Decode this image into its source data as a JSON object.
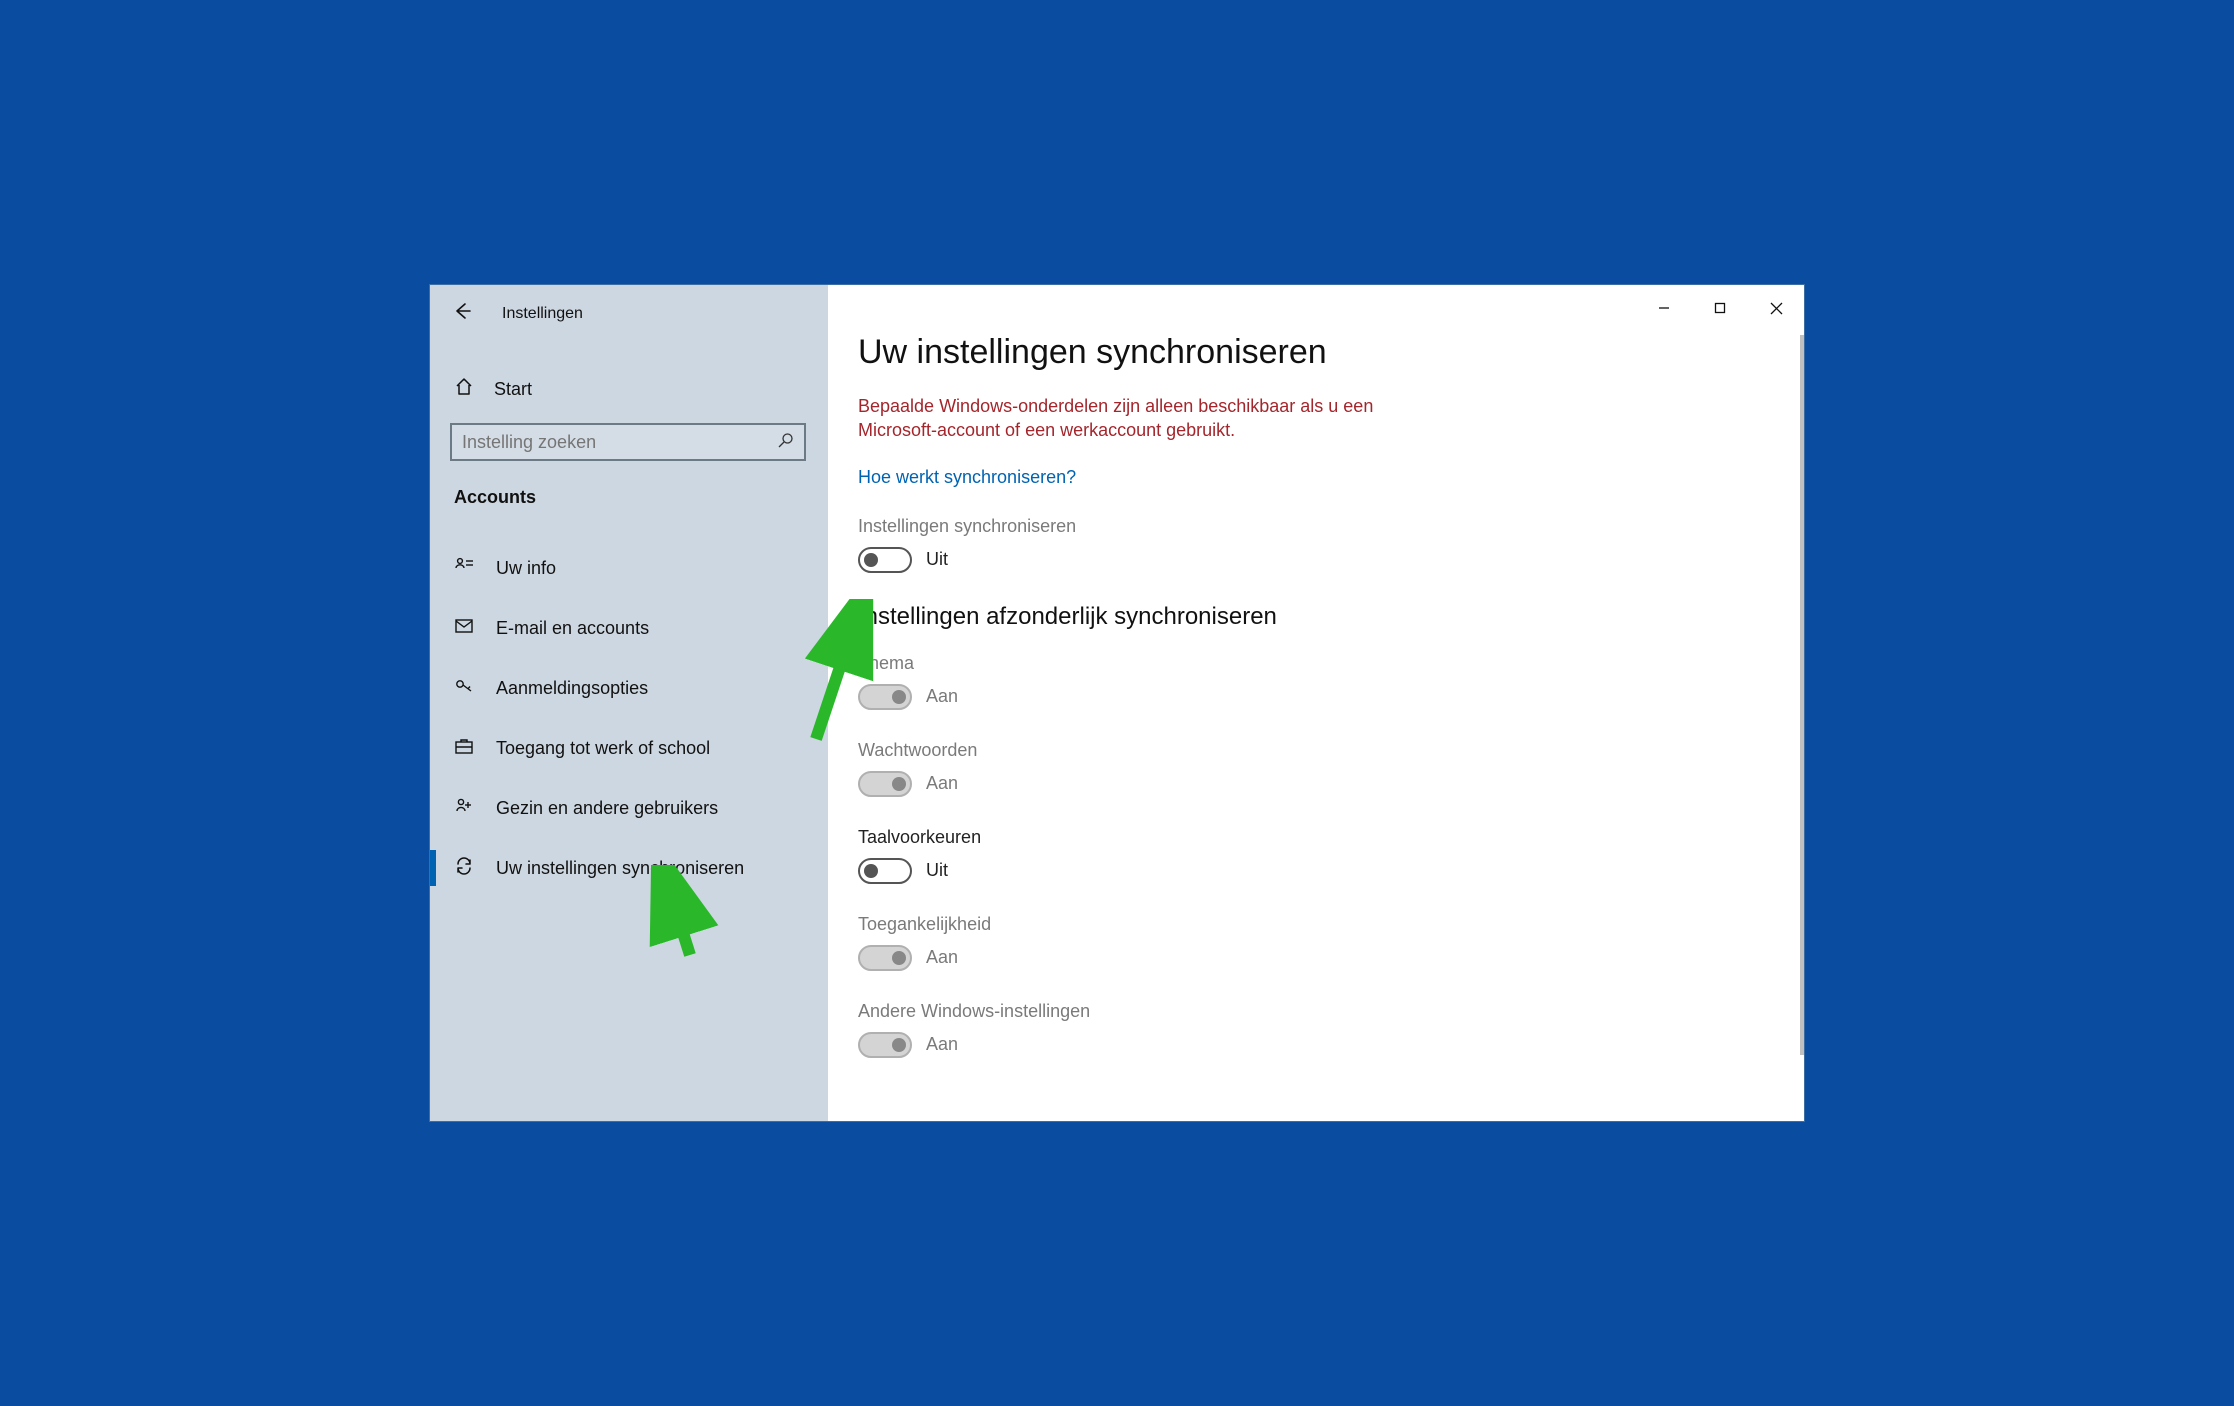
{
  "window": {
    "title": "Instellingen"
  },
  "sidebar": {
    "home_label": "Start",
    "search_placeholder": "Instelling zoeken",
    "category": "Accounts",
    "items": [
      {
        "icon": "person-card",
        "label": "Uw info"
      },
      {
        "icon": "mail",
        "label": "E-mail en accounts"
      },
      {
        "icon": "key",
        "label": "Aanmeldingsopties"
      },
      {
        "icon": "briefcase",
        "label": "Toegang tot werk of school"
      },
      {
        "icon": "family",
        "label": "Gezin en andere gebruikers"
      },
      {
        "icon": "sync",
        "label": "Uw instellingen synchroniseren"
      }
    ]
  },
  "main": {
    "heading": "Uw instellingen synchroniseren",
    "warning": "Bepaalde Windows-onderdelen zijn alleen beschikbaar als u een Microsoft-account of een werkaccount gebruikt.",
    "help_link": "Hoe werkt synchroniseren?",
    "master_toggle": {
      "label": "Instellingen synchroniseren",
      "state_label": "Uit"
    },
    "section_heading": "Instellingen afzonderlijk synchroniseren",
    "toggles": [
      {
        "label": "Thema",
        "state_label": "Aan",
        "on": true,
        "disabled": true
      },
      {
        "label": "Wachtwoorden",
        "state_label": "Aan",
        "on": true,
        "disabled": true
      },
      {
        "label": "Taalvoorkeuren",
        "state_label": "Uit",
        "on": false,
        "disabled": false
      },
      {
        "label": "Toegankelijkheid",
        "state_label": "Aan",
        "on": true,
        "disabled": true
      },
      {
        "label": "Andere Windows-instellingen",
        "state_label": "Aan",
        "on": true,
        "disabled": true
      }
    ]
  }
}
